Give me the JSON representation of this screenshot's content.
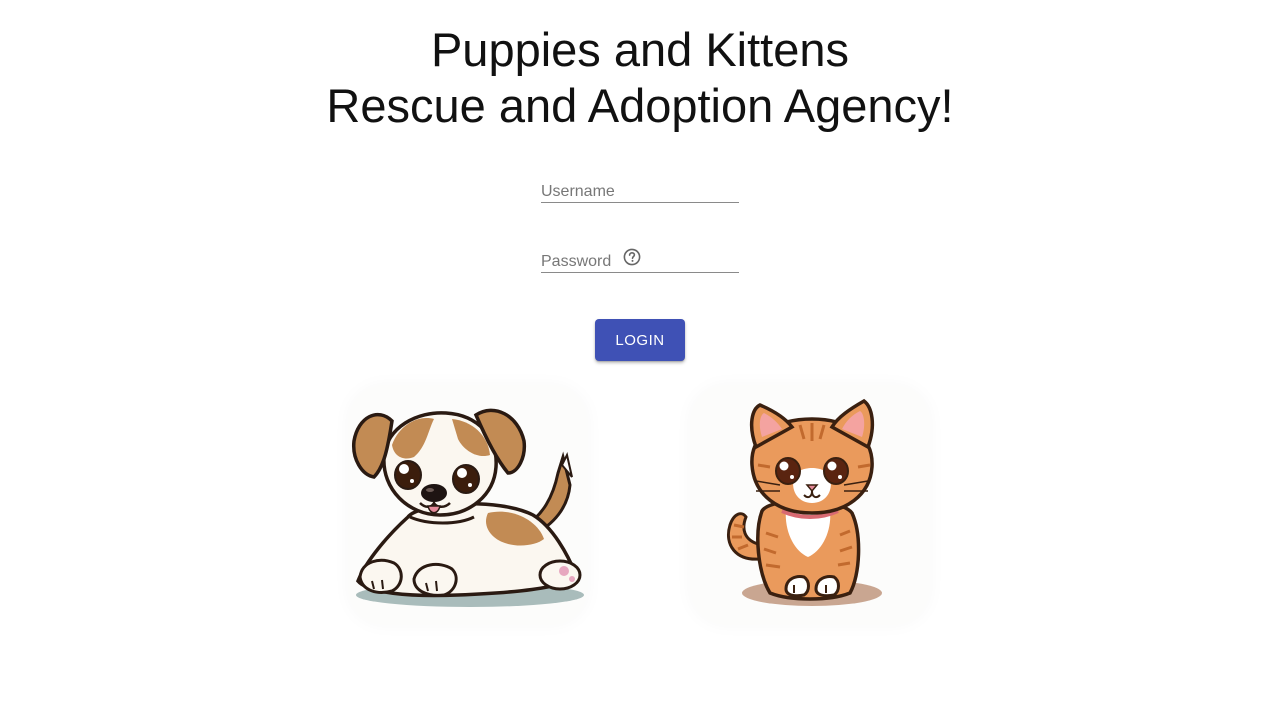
{
  "header": {
    "title_line1": "Puppies and Kittens",
    "title_line2": "Rescue and Adoption Agency!"
  },
  "login_form": {
    "username_label": "Username",
    "username_value": "",
    "password_label": "Password",
    "password_value": "",
    "help_icon": "help-circle-icon",
    "login_label": "LOGIN"
  },
  "images": {
    "puppy": "cartoon-puppy-illustration",
    "kitten": "cartoon-kitten-illustration"
  },
  "colors": {
    "primary": "#3f51b5",
    "title": "#111111",
    "label": "#777777"
  }
}
